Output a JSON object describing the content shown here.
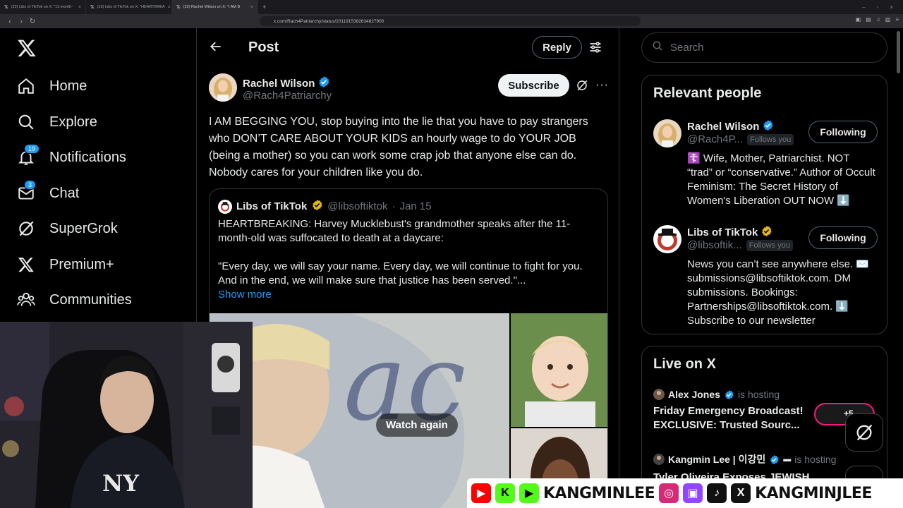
{
  "browser": {
    "tabs": [
      {
        "title": "(23) Libs of TikTok on X: \"11-month-",
        "active": false
      },
      {
        "title": "(23) Libs of TikTok on X: \"HEARTBREA",
        "active": false
      },
      {
        "title": "(22) Rachel Wilson on X: \"I AM B",
        "active": true
      }
    ],
    "url": "x.com/Rach4Patriarchy/status/2011915382634827900"
  },
  "nav": {
    "items": [
      {
        "label": "Home",
        "icon": "home-icon"
      },
      {
        "label": "Explore",
        "icon": "search-icon"
      },
      {
        "label": "Notifications",
        "icon": "bell-icon",
        "badge": "19"
      },
      {
        "label": "Chat",
        "icon": "mail-icon",
        "badge": "3"
      },
      {
        "label": "SuperGrok",
        "icon": "grok-icon"
      },
      {
        "label": "Premium+",
        "icon": "x-logo-icon"
      },
      {
        "label": "Communities",
        "icon": "people-icon"
      }
    ]
  },
  "header": {
    "title": "Post",
    "reply_label": "Reply"
  },
  "post": {
    "author_name": "Rachel Wilson",
    "author_handle": "@Rach4Patriarchy",
    "subscribe_label": "Subscribe",
    "text": "I AM BEGGING YOU, stop buying into the lie that you have to pay strangers who DON’T CARE ABOUT YOUR KIDS an hourly wage to do YOUR JOB (being a mother) so you can work some crap job that anyone else can do. Nobody cares for your children like you do."
  },
  "quote": {
    "name": "Libs of TikTok",
    "handle": "@libsoftiktok",
    "date": "Jan 15",
    "para1": "HEARTBREAKING: Harvey Mucklebust's grandmother speaks after the 11-month-old was suffocated to death at a daycare:",
    "para2": "\"Every day, we will say your name. Every day, we will continue to fight for you. And in the end, we will make sure that justice has been served.\"...",
    "show_more": "Show more",
    "watch_again": "Watch again"
  },
  "sidebar": {
    "search_placeholder": "Search",
    "relevant_title": "Relevant people",
    "people": [
      {
        "name": "Rachel Wilson",
        "handle": "@Rach4P...",
        "follows_you": "Follows you",
        "button": "Following",
        "bio": "☦️ Wife, Mother, Patriarchist. NOT “trad” or “conservative.” Author of Occult Feminism: The Secret History of Women's Liberation OUT NOW ⬇️"
      },
      {
        "name": "Libs of TikTok",
        "handle": "@libsoftik...",
        "follows_you": "Follows you",
        "button": "Following",
        "bio": "News you can’t see anywhere else. ✉️ submissions@libsoftiktok.com. DM submissions. Bookings: Partnerships@libsoftiktok.com. ⬇️ Subscribe to our newsletter"
      }
    ],
    "live_title": "Live on X",
    "live": [
      {
        "host": "Alex Jones",
        "hosting": "is hosting",
        "title": "Friday Emergency Broadcast! EXCLUSIVE: Trusted Sourc...",
        "pill": "+5"
      },
      {
        "host": "Kangmin Lee | 이강민",
        "hosting": "is hosting",
        "title": "Tyler Oliveira Exposes JEWISH",
        "pill": ""
      }
    ]
  },
  "banner": {
    "left_text": "KANGMINLEE",
    "right_text": "KANGMINJLEE"
  },
  "colors": {
    "accent": "#1d9bf0",
    "bg": "#000000",
    "border": "#2f3336",
    "muted": "#71767b",
    "gold": "#e2b719",
    "live_pink": "#f91880"
  }
}
